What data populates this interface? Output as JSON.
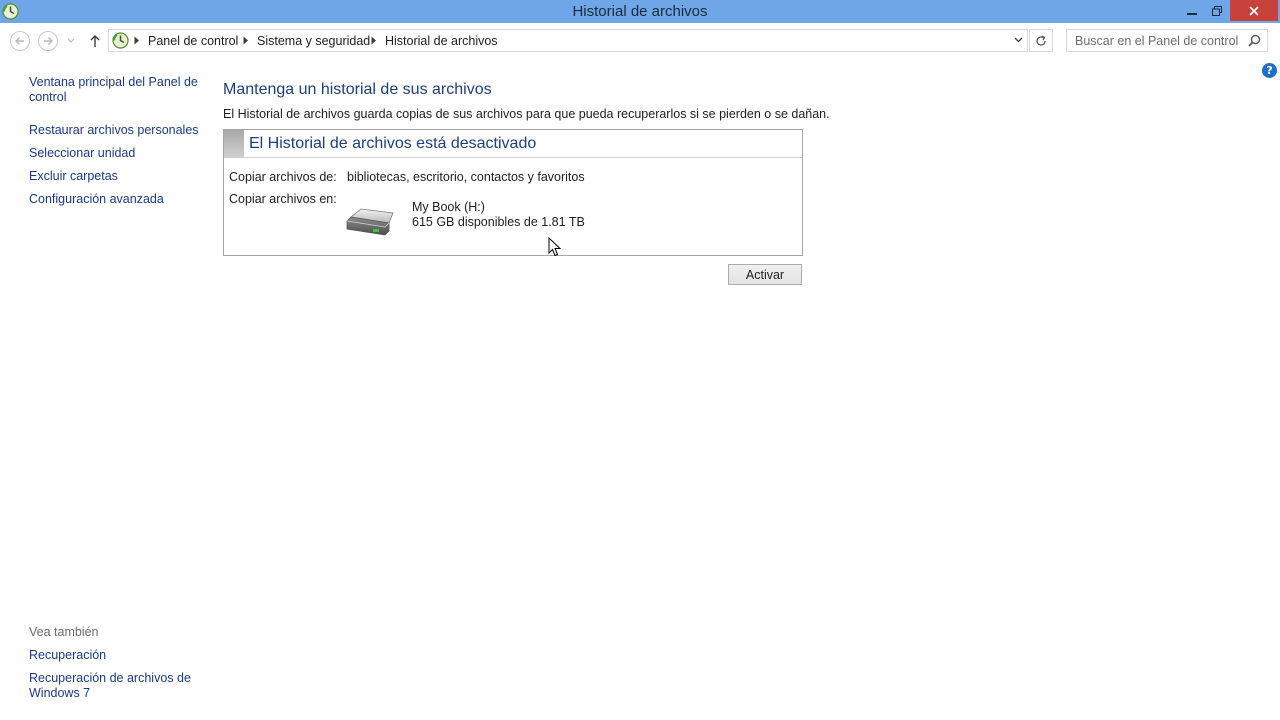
{
  "window": {
    "title": "Historial de archivos"
  },
  "navigation": {
    "breadcrumbs": [
      "Panel de control",
      "Sistema y seguridad",
      "Historial de archivos"
    ],
    "search_placeholder": "Buscar en el Panel de control"
  },
  "left_pane": {
    "links": [
      "Ventana principal del Panel de control",
      "Restaurar archivos personales",
      "Seleccionar unidad",
      "Excluir carpetas",
      "Configuración avanzada"
    ],
    "see_also_title": "Vea también",
    "see_also": [
      "Recuperación",
      "Recuperación de archivos de Windows 7"
    ]
  },
  "main": {
    "heading": "Mantenga un historial de sus archivos",
    "description": "El Historial de archivos guarda copias de sus archivos para que pueda recuperarlos si se pierden o se dañan.",
    "status_title": "El Historial de archivos está desactivado",
    "copy_from_label": "Copiar archivos de:",
    "copy_from_value": "bibliotecas, escritorio, contactos y favoritos",
    "copy_to_label": "Copiar archivos en:",
    "drive_name": "My Book (H:)",
    "drive_space": "615 GB disponibles de 1.81 TB",
    "activate_label": "Activar"
  },
  "colors": {
    "titlebar": "#6fa6e8",
    "close_button": "#c7403a",
    "link": "#1a3a88",
    "heading": "#1e3f7d",
    "help": "#1e6fc7"
  },
  "icons": {
    "app": "file-history-icon",
    "drive": "hard-drive-icon",
    "help": "help-icon"
  }
}
